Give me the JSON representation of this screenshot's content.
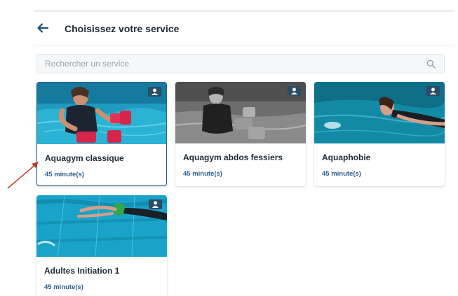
{
  "header": {
    "title": "Choisissez votre service",
    "back_icon": "arrow-left-icon"
  },
  "search": {
    "placeholder": "Rechercher un service",
    "icon": "search-icon"
  },
  "services": [
    {
      "name": "Aquagym classique",
      "duration": "45 minute(s)",
      "selected": true,
      "badge_icon": "person-icon"
    },
    {
      "name": "Aquagym abdos fessiers",
      "duration": "45 minute(s)",
      "selected": false,
      "badge_icon": "person-icon"
    },
    {
      "name": "Aquaphobie",
      "duration": "45 minute(s)",
      "selected": false,
      "badge_icon": "person-icon"
    },
    {
      "name": "Adultes Initiation 1",
      "duration": "45 minute(s)",
      "selected": false,
      "badge_icon": "person-icon"
    }
  ],
  "colors": {
    "accent": "#2b5d8a",
    "badge": "#2a4d66",
    "annotation_arrow": "#c0392b"
  }
}
